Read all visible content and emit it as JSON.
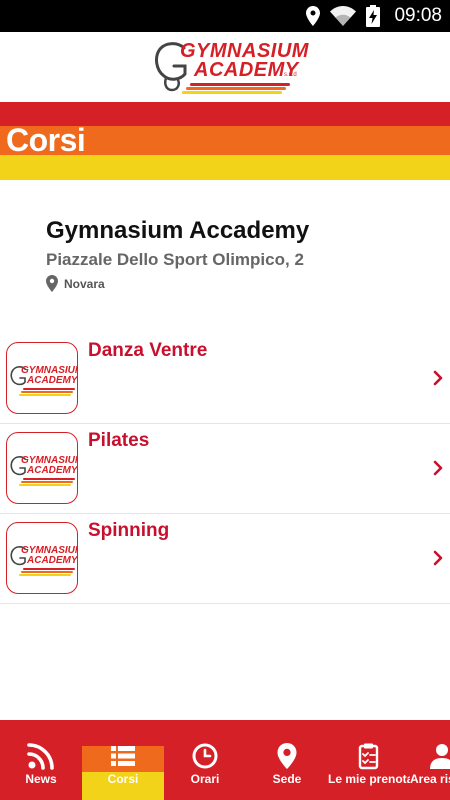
{
  "status_bar": {
    "time": "09:08",
    "icons": [
      "location-icon",
      "wifi-icon",
      "battery-charging-icon"
    ]
  },
  "header": {
    "logo_line1": "GYMNASIUM",
    "logo_line2": "ACADEMY",
    "logo_suffix": "s.s.d",
    "brand_colors": {
      "red": "#d62027",
      "orange": "#ef6a1c",
      "yellow": "#f3d21a"
    }
  },
  "page": {
    "title": "Corsi"
  },
  "club": {
    "name": "Gymnasium Accademy",
    "address": "Piazzale Dello Sport Olimpico, 2",
    "city": "Novara",
    "city_icon": "map-pin-icon"
  },
  "courses": [
    {
      "name": "Danza Ventre",
      "thumb_line1": "GYMNASIUM",
      "thumb_line2": "ACADEMY"
    },
    {
      "name": "Pilates",
      "thumb_line1": "GYMNASIUM",
      "thumb_line2": "ACADEMY"
    },
    {
      "name": "Spinning",
      "thumb_line1": "GYMNASIUM",
      "thumb_line2": "ACADEMY"
    }
  ],
  "bottom_nav": {
    "items": [
      {
        "label": "News",
        "icon": "rss-icon",
        "active": false
      },
      {
        "label": "Corsi",
        "icon": "list-icon",
        "active": true
      },
      {
        "label": "Orari",
        "icon": "clock-icon",
        "active": false
      },
      {
        "label": "Sede",
        "icon": "map-pin-icon",
        "active": false
      },
      {
        "label": "Le mie prenotazioni",
        "icon": "clipboard-icon",
        "active": false
      },
      {
        "label": "Area riservata",
        "icon": "user-icon",
        "active": false
      }
    ]
  }
}
